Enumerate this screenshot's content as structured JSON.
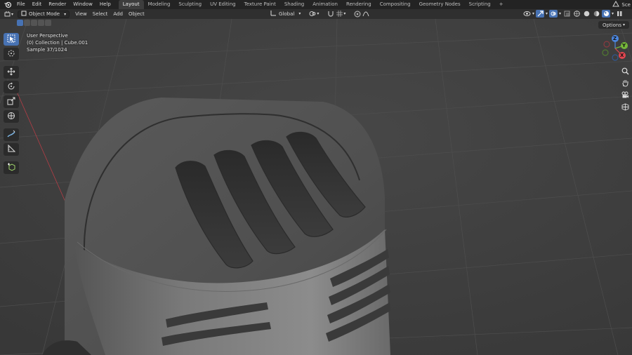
{
  "topbar": {
    "menus": [
      "File",
      "Edit",
      "Render",
      "Window",
      "Help"
    ],
    "workspaces": [
      "Layout",
      "Modeling",
      "Sculpting",
      "UV Editing",
      "Texture Paint",
      "Shading",
      "Animation",
      "Rendering",
      "Compositing",
      "Geometry Nodes",
      "Scripting"
    ],
    "active_workspace": "Layout",
    "add_tab": "+",
    "scene_label": "Sce"
  },
  "header": {
    "mode": "Object Mode",
    "menus": [
      "View",
      "Select",
      "Add",
      "Object"
    ],
    "orientation": "Global"
  },
  "viewport": {
    "overlay_lines": [
      "User Perspective",
      "(0) Collection | Cube.001",
      "Sample 37/1024"
    ],
    "options_label": "Options"
  },
  "gizmo": {
    "z": "Z",
    "y": "Y",
    "x": "X"
  },
  "colors": {
    "accent": "#4772b3",
    "x_axis": "#e04650",
    "y_axis": "#75b63a",
    "z_axis": "#4c87e0"
  },
  "icons": {
    "toolbar": [
      "select-box-icon",
      "cursor-icon",
      "move-icon",
      "rotate-icon",
      "scale-icon",
      "transform-icon",
      "annotate-icon",
      "measure-icon",
      "add-cube-icon"
    ],
    "nav": [
      "zoom-icon",
      "pan-hand-icon",
      "camera-icon",
      "ortho-grid-icon"
    ]
  }
}
